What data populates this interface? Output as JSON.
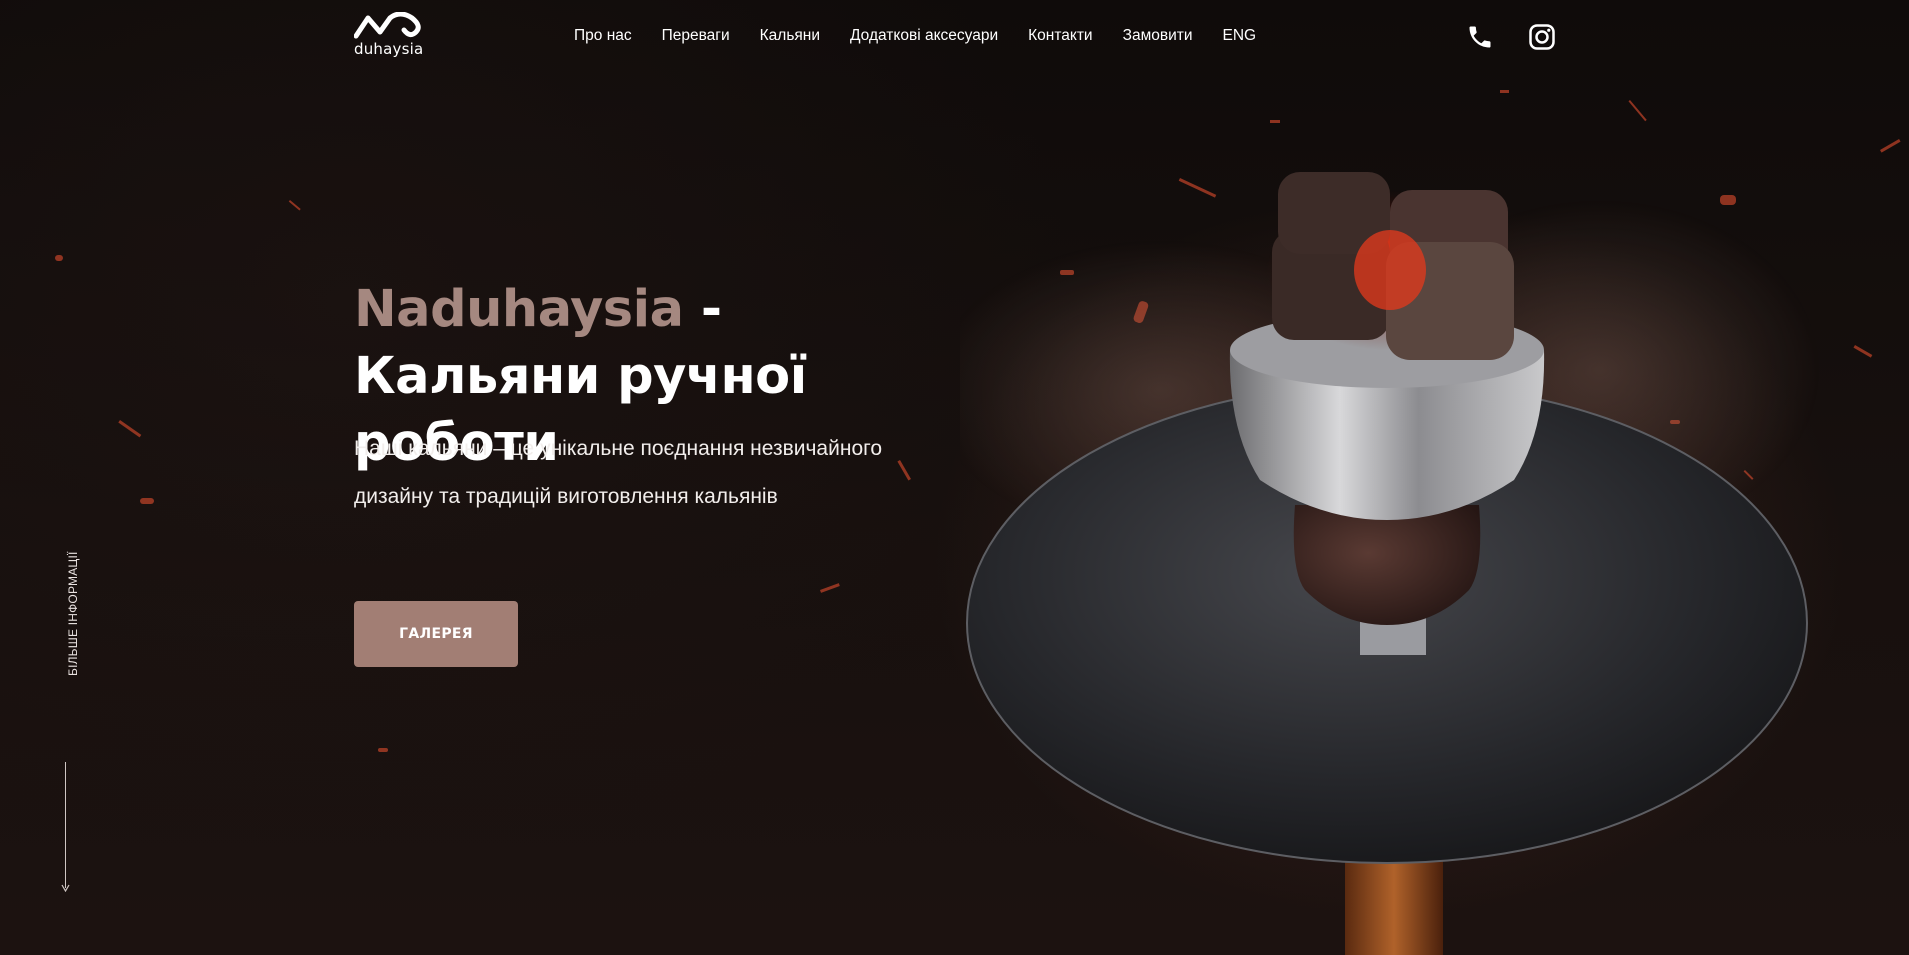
{
  "header": {
    "logo_text": "duhaysia",
    "nav": [
      "Про нас",
      "Переваги",
      "Кальяни",
      "Додаткові аксесуари",
      "Контакти",
      "Замовити",
      "ENG"
    ],
    "icons": {
      "phone": "phone-icon",
      "instagram": "instagram-icon"
    }
  },
  "hero": {
    "brand": "Naduhaysia",
    "title_rest": " - Кальяни ручної роботи",
    "subtitle": "Наші кальяни – це унікальне поєднання незвичайного дизайну та традицій виготовлення кальянів",
    "button": "ГАЛЕРЕЯ"
  },
  "side": {
    "more_info": "БІЛЬШЕ ІНФОРМАЦІЇ"
  },
  "colors": {
    "accent": "#a27e74",
    "brand_text": "#a58880",
    "background": "#120d0c"
  }
}
